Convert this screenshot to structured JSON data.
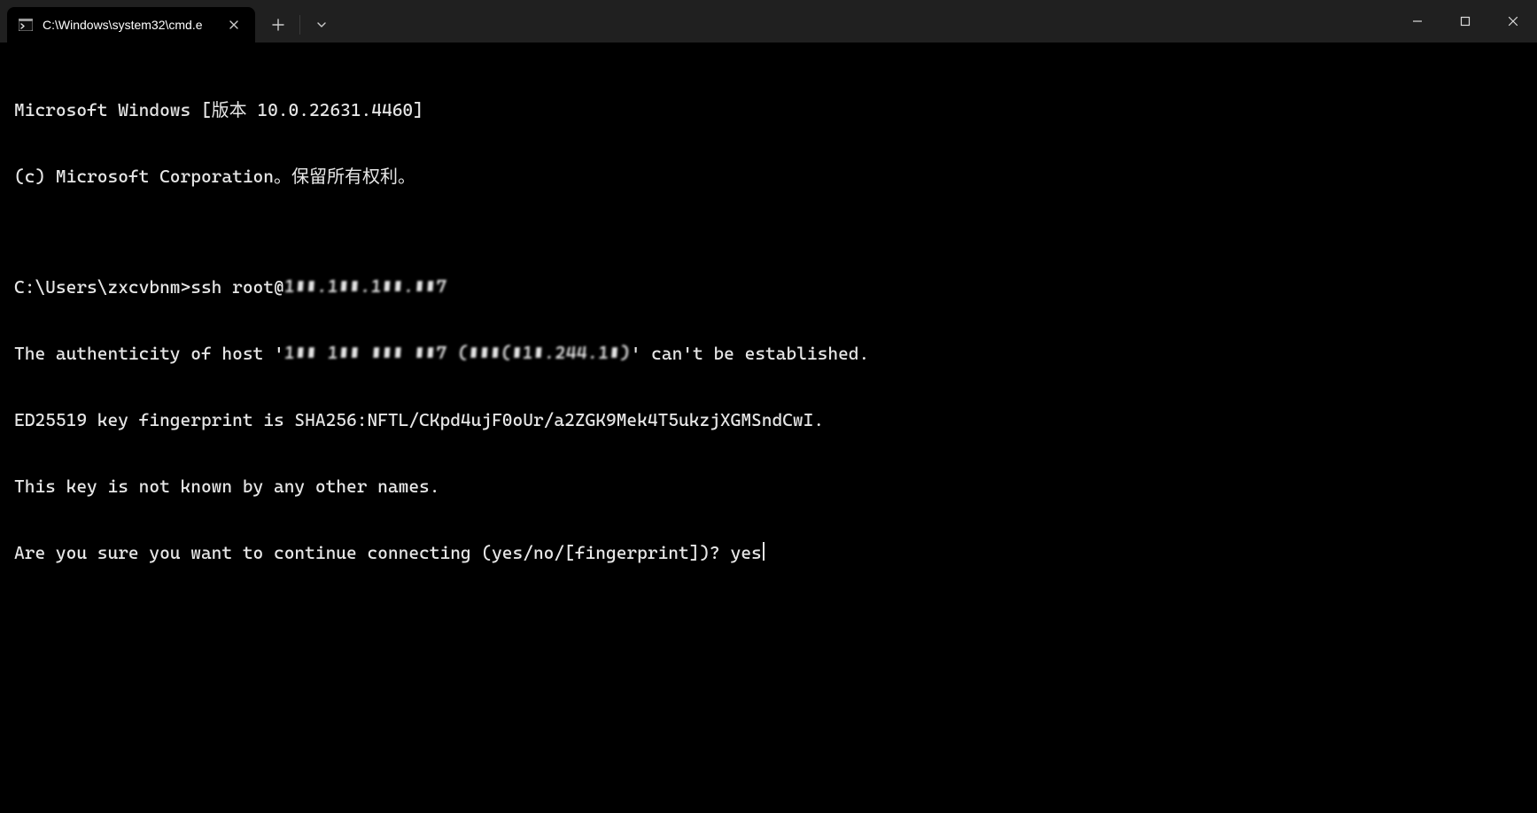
{
  "window": {
    "tab_title": "C:\\Windows\\system32\\cmd.e",
    "icons": {
      "tab": "cmd-icon",
      "close_tab": "close-icon",
      "new_tab": "plus-icon",
      "tab_menu": "chevron-down-icon",
      "minimize": "minimize-icon",
      "maximize": "maximize-icon",
      "close": "close-icon"
    }
  },
  "terminal": {
    "banner_line1": "Microsoft Windows [版本 10.0.22631.4460]",
    "banner_line2": "(c) Microsoft Corporation。保留所有权利。",
    "blank1": "",
    "prompt_prefix": "C:\\Users\\zxcvbnm>",
    "command_prefix": "ssh root@",
    "command_host_obscured": "1▮▮.1▮▮.1▮▮.▮▮7",
    "auth_prefix": "The authenticity of host '",
    "auth_host_obscured": "1▮▮ 1▮▮ ▮▮▮ ▮▮7 (▮▮▮(▮1▮.244.1▮)",
    "auth_suffix": "' can't be established.",
    "fingerprint_line": "ED25519 key fingerprint is SHA256:NFTL/CKpd4ujF0oUr/a2ZGK9Mek4T5ukzjXGMSndCwI.",
    "known_names_line": "This key is not known by any other names.",
    "confirm_prompt": "Are you sure you want to continue connecting (yes/no/[fingerprint])? ",
    "confirm_input": "yes"
  }
}
